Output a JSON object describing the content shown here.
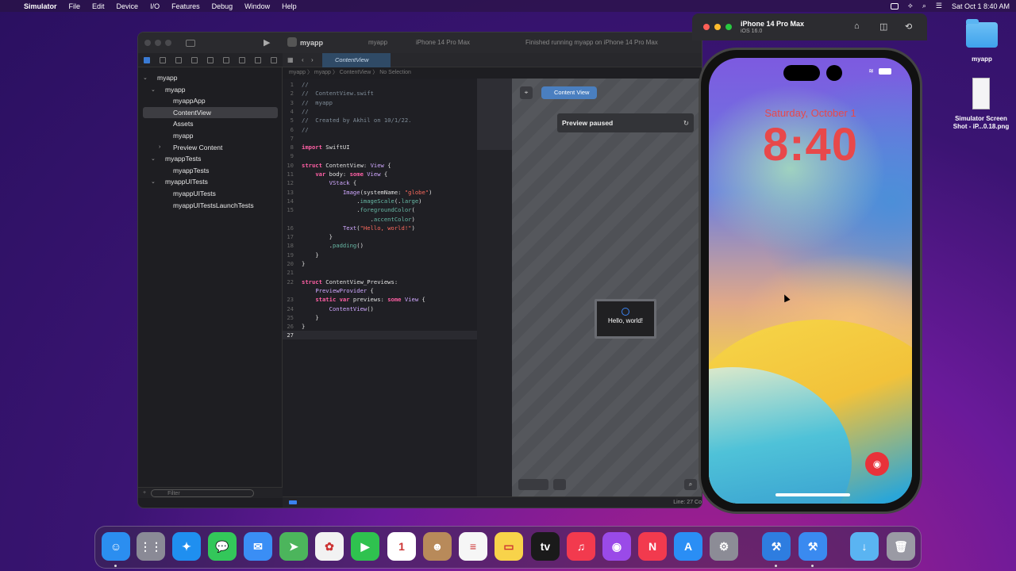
{
  "menubar": {
    "app": "Simulator",
    "items": [
      "File",
      "Edit",
      "Device",
      "I/O",
      "Features",
      "Debug",
      "Window",
      "Help"
    ],
    "datetime": "Sat Oct 1  8:40 AM"
  },
  "xcode": {
    "project": "myapp",
    "scheme": "myapp",
    "device": "iPhone 14 Pro Max",
    "status": "Finished running myapp on iPhone 14 Pro Max",
    "active_tab": "ContentView",
    "jumpbar": "myapp 〉 myapp 〉 ContentView 〉 No Selection",
    "navigator": [
      {
        "label": "myapp",
        "depth": 0,
        "chevron": "⌄"
      },
      {
        "label": "myapp",
        "depth": 1,
        "chevron": "⌄"
      },
      {
        "label": "myappApp",
        "depth": 2,
        "chevron": ""
      },
      {
        "label": "ContentView",
        "depth": 2,
        "chevron": "",
        "selected": true
      },
      {
        "label": "Assets",
        "depth": 2,
        "chevron": ""
      },
      {
        "label": "myapp",
        "depth": 2,
        "chevron": ""
      },
      {
        "label": "Preview Content",
        "depth": 2,
        "chevron": "›"
      },
      {
        "label": "myappTests",
        "depth": 1,
        "chevron": "⌄"
      },
      {
        "label": "myappTests",
        "depth": 2,
        "chevron": ""
      },
      {
        "label": "myappUITests",
        "depth": 1,
        "chevron": "⌄"
      },
      {
        "label": "myappUITests",
        "depth": 2,
        "chevron": ""
      },
      {
        "label": "myappUITestsLaunchTests",
        "depth": 2,
        "chevron": ""
      }
    ],
    "filter_placeholder": "Filter",
    "code": [
      {
        "n": "1",
        "t": [
          [
            "cmt",
            "//"
          ]
        ]
      },
      {
        "n": "2",
        "t": [
          [
            "cmt",
            "//  ContentView.swift"
          ]
        ]
      },
      {
        "n": "3",
        "t": [
          [
            "cmt",
            "//  myapp"
          ]
        ]
      },
      {
        "n": "4",
        "t": [
          [
            "cmt",
            "//"
          ]
        ]
      },
      {
        "n": "5",
        "t": [
          [
            "cmt",
            "//  Created by Akhil on 10/1/22."
          ]
        ]
      },
      {
        "n": "6",
        "t": [
          [
            "cmt",
            "//"
          ]
        ]
      },
      {
        "n": "7",
        "t": []
      },
      {
        "n": "8",
        "t": [
          [
            "kw",
            "import"
          ],
          [
            "plain",
            " SwiftUI"
          ]
        ]
      },
      {
        "n": "9",
        "t": []
      },
      {
        "n": "10",
        "t": [
          [
            "kw",
            "struct"
          ],
          [
            "plain",
            " ContentView: "
          ],
          [
            "ty",
            "View"
          ],
          [
            "plain",
            " {"
          ]
        ]
      },
      {
        "n": "11",
        "t": [
          [
            "plain",
            "    "
          ],
          [
            "kw",
            "var"
          ],
          [
            "plain",
            " body: "
          ],
          [
            "kw",
            "some"
          ],
          [
            "plain",
            " "
          ],
          [
            "ty",
            "View"
          ],
          [
            "plain",
            " {"
          ]
        ]
      },
      {
        "n": "12",
        "t": [
          [
            "plain",
            "        "
          ],
          [
            "ty",
            "VStack"
          ],
          [
            "plain",
            " {"
          ]
        ]
      },
      {
        "n": "13",
        "t": [
          [
            "plain",
            "            "
          ],
          [
            "ty",
            "Image"
          ],
          [
            "plain",
            "(systemName: "
          ],
          [
            "str",
            "\"globe\""
          ],
          [
            "plain",
            ")"
          ]
        ]
      },
      {
        "n": "14",
        "t": [
          [
            "plain",
            "                ."
          ],
          [
            "fn",
            "imageScale"
          ],
          [
            "plain",
            "(."
          ],
          [
            "fn",
            "large"
          ],
          [
            "plain",
            ")"
          ]
        ]
      },
      {
        "n": "15",
        "t": [
          [
            "plain",
            "                ."
          ],
          [
            "fn",
            "foregroundColor"
          ],
          [
            "plain",
            "("
          ]
        ]
      },
      {
        "n": "",
        "t": [
          [
            "plain",
            "                    ."
          ],
          [
            "fn",
            "accentColor"
          ],
          [
            "plain",
            ")"
          ]
        ]
      },
      {
        "n": "16",
        "t": [
          [
            "plain",
            "            "
          ],
          [
            "ty",
            "Text"
          ],
          [
            "plain",
            "("
          ],
          [
            "str",
            "\"Hello, world!\""
          ],
          [
            "plain",
            ")"
          ]
        ]
      },
      {
        "n": "17",
        "t": [
          [
            "plain",
            "        }"
          ]
        ]
      },
      {
        "n": "18",
        "t": [
          [
            "plain",
            "        ."
          ],
          [
            "fn",
            "padding"
          ],
          [
            "plain",
            "()"
          ]
        ]
      },
      {
        "n": "19",
        "t": [
          [
            "plain",
            "    }"
          ]
        ]
      },
      {
        "n": "20",
        "t": [
          [
            "plain",
            "}"
          ]
        ]
      },
      {
        "n": "21",
        "t": []
      },
      {
        "n": "22",
        "t": [
          [
            "kw",
            "struct"
          ],
          [
            "plain",
            " ContentView_Previews:"
          ]
        ]
      },
      {
        "n": "",
        "t": [
          [
            "plain",
            "    "
          ],
          [
            "ty",
            "PreviewProvider"
          ],
          [
            "plain",
            " {"
          ]
        ]
      },
      {
        "n": "23",
        "t": [
          [
            "plain",
            "    "
          ],
          [
            "kw",
            "static"
          ],
          [
            "plain",
            " "
          ],
          [
            "kw",
            "var"
          ],
          [
            "plain",
            " previews: "
          ],
          [
            "kw",
            "some"
          ],
          [
            "plain",
            " "
          ],
          [
            "ty",
            "View"
          ],
          [
            "plain",
            " {"
          ]
        ]
      },
      {
        "n": "24",
        "t": [
          [
            "plain",
            "        "
          ],
          [
            "ty",
            "ContentView"
          ],
          [
            "plain",
            "()"
          ]
        ]
      },
      {
        "n": "25",
        "t": [
          [
            "plain",
            "    }"
          ]
        ]
      },
      {
        "n": "26",
        "t": [
          [
            "plain",
            "}"
          ]
        ]
      },
      {
        "n": "27",
        "t": [],
        "current": true
      }
    ],
    "canvas": {
      "content_view_label": "Content View",
      "paused_label": "Preview paused",
      "hello_text": "Hello, world!"
    },
    "linecol": "Line: 27  Co"
  },
  "simulator": {
    "device": "iPhone 14 Pro Max",
    "os": "iOS 16.0",
    "lock_date": "Saturday, October 1",
    "lock_time": "8:40"
  },
  "desktop": [
    {
      "label": "myapp",
      "kind": "folder"
    },
    {
      "label": "Simulator Screen Shot - iP...0.18.png",
      "kind": "screenshot"
    }
  ],
  "dock": [
    {
      "name": "finder",
      "glyph": "☺",
      "color": "#2b8ef0",
      "running": true
    },
    {
      "name": "launchpad",
      "glyph": "⋮⋮",
      "color": "#8a8a96",
      "running": false
    },
    {
      "name": "safari",
      "glyph": "✦",
      "color": "#1f8ff0",
      "running": false
    },
    {
      "name": "messages",
      "glyph": "💬",
      "color": "#33c75a",
      "running": false
    },
    {
      "name": "mail",
      "glyph": "✉",
      "color": "#3a8ef5",
      "running": false
    },
    {
      "name": "maps",
      "glyph": "➤",
      "color": "#4cb55c",
      "running": false
    },
    {
      "name": "photos",
      "glyph": "✿",
      "color": "#f2f2f2",
      "running": false
    },
    {
      "name": "facetime",
      "glyph": "▶",
      "color": "#2fc24f",
      "running": false
    },
    {
      "name": "calendar",
      "glyph": "1",
      "color": "#ffffff",
      "running": false
    },
    {
      "name": "contacts",
      "glyph": "☻",
      "color": "#b88a5a",
      "running": false
    },
    {
      "name": "reminders",
      "glyph": "≡",
      "color": "#f6f6f6",
      "running": false
    },
    {
      "name": "notes",
      "glyph": "▭",
      "color": "#f8d34a",
      "running": false
    },
    {
      "name": "tv",
      "glyph": "tv",
      "color": "#1a1a1a",
      "running": false
    },
    {
      "name": "music",
      "glyph": "♫",
      "color": "#f23a4e",
      "running": false
    },
    {
      "name": "podcasts",
      "glyph": "◉",
      "color": "#9a4ae8",
      "running": false
    },
    {
      "name": "news",
      "glyph": "N",
      "color": "#f23a4e",
      "running": false
    },
    {
      "name": "app-store",
      "glyph": "A",
      "color": "#2a8ef5",
      "running": false
    },
    {
      "name": "system-settings",
      "glyph": "⚙",
      "color": "#8c8c96",
      "running": false
    },
    {
      "name": "xcode",
      "glyph": "⚒",
      "color": "#2e7de0",
      "running": true
    },
    {
      "name": "simulator",
      "glyph": "⚒",
      "color": "#3a8af0",
      "running": true
    },
    {
      "name": "downloads",
      "glyph": "↓",
      "color": "#5ab4f2",
      "running": false
    },
    {
      "name": "trash",
      "glyph": "🗑",
      "color": "#9a9aa4",
      "running": false
    }
  ]
}
